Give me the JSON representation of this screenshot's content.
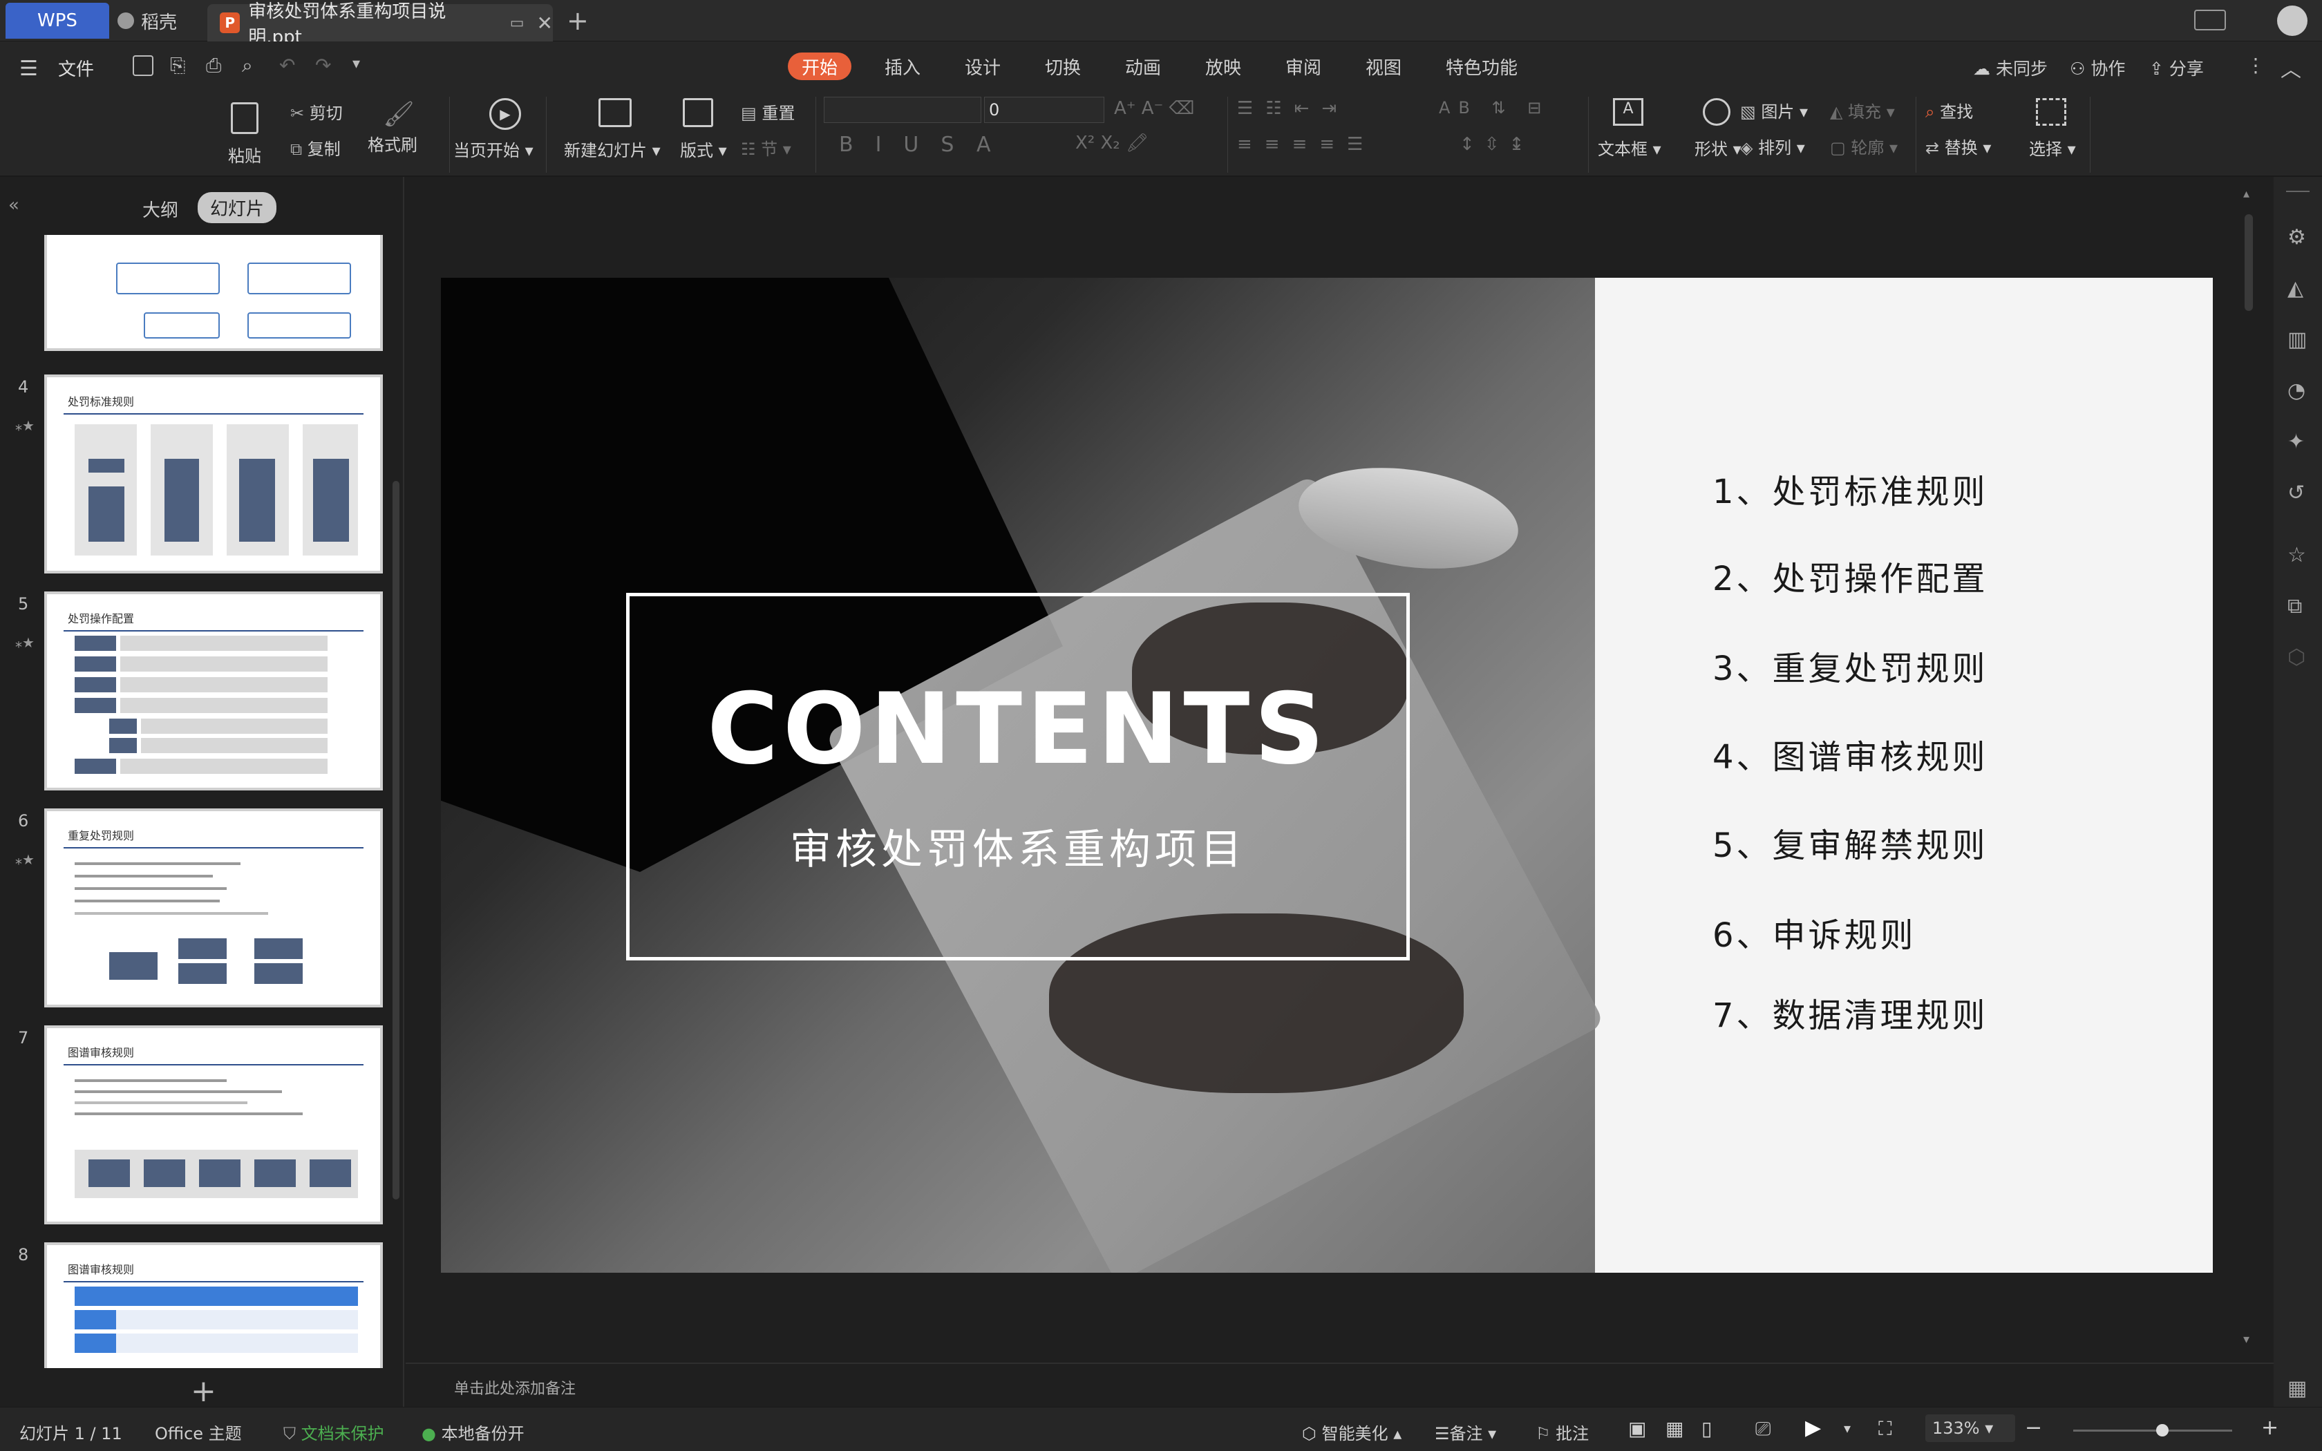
{
  "window": {
    "tabs": [
      {
        "label": "WPS"
      },
      {
        "label": "稻壳"
      },
      {
        "label": "审核处罚体系重构项目说明.ppt"
      }
    ]
  },
  "menu": {
    "file": "文件",
    "tabs": [
      "开始",
      "插入",
      "设计",
      "切换",
      "动画",
      "放映",
      "审阅",
      "视图",
      "特色功能"
    ],
    "sync": "未同步",
    "collab": "协作",
    "share": "分享"
  },
  "ribbon": {
    "paste": "粘贴",
    "cut": "剪切",
    "copy": "复制",
    "format_painter": "格式刷",
    "from_current": "当页开始",
    "new_slide": "新建幻灯片",
    "layout": "版式",
    "reset": "重置",
    "section": "节",
    "font_size": "0",
    "textbox": "文本框",
    "shape": "形状",
    "picture": "图片",
    "fill": "填充",
    "arrange": "排列",
    "outline": "轮廓",
    "find": "查找",
    "replace": "替换",
    "select": "选择"
  },
  "panel": {
    "outline_tab": "大纲",
    "slides_tab": "幻灯片",
    "thumbnails": [
      {
        "num": "4",
        "title": "处罚标准规则"
      },
      {
        "num": "5",
        "title": "处罚操作配置"
      },
      {
        "num": "6",
        "title": "重复处罚规则"
      },
      {
        "num": "7",
        "title": "图谱审核规则"
      },
      {
        "num": "8",
        "title": "图谱审核规则"
      }
    ]
  },
  "slide": {
    "heading": "CONTENTS",
    "subtitle": "审核处罚体系重构项目",
    "items": [
      "1、处罚标准规则",
      "2、处罚操作配置",
      "3、重复处罚规则",
      "4、图谱审核规则",
      "5、复审解禁规则",
      "6、申诉规则",
      "7、数据清理规则"
    ]
  },
  "notes_placeholder": "单击此处添加备注",
  "status": {
    "slide_counter": "幻灯片 1 / 11",
    "theme": "Office 主题",
    "protect": "文档未保护",
    "backup": "本地备份开",
    "beautify": "智能美化",
    "notes": "备注",
    "comment": "批注",
    "zoom": "133%"
  },
  "colors": {
    "accent": "#e8603a",
    "wps_blue": "#3a63c8",
    "protect_green": "#4caf50"
  }
}
